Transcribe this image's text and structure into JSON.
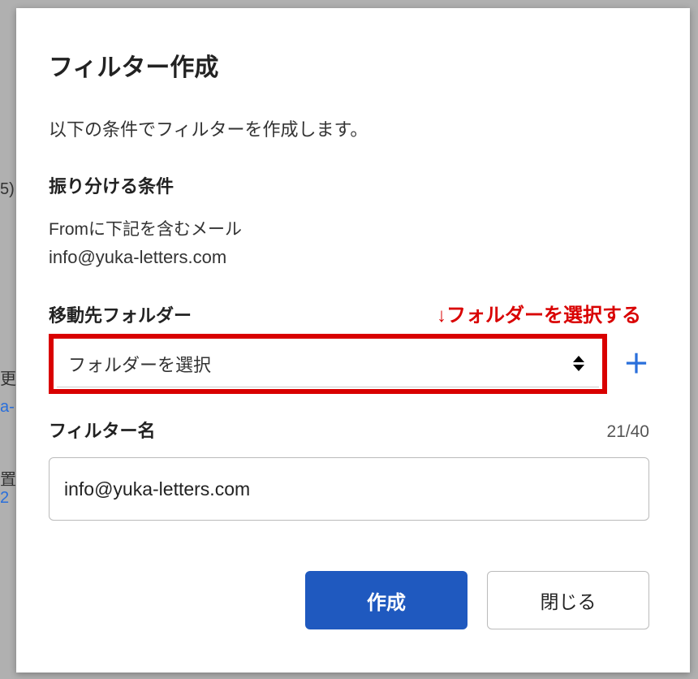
{
  "dialog": {
    "title": "フィルター作成",
    "intro": "以下の条件でフィルターを作成します。",
    "conditions_label": "振り分ける条件",
    "condition_line1": "Fromに下記を含むメール",
    "condition_line2": "info@yuka-letters.com",
    "folder_label": "移動先フォルダー",
    "annotation": "↓フォルダーを選択する",
    "folder_placeholder": "フォルダーを選択",
    "plus_symbol": "＋",
    "filtername_label": "フィルター名",
    "filtername_counter": "21/40",
    "filtername_value": "info@yuka-letters.com",
    "create_btn": "作成",
    "close_btn": "閉じる"
  },
  "background_fragments": {
    "frag1": "5)",
    "frag2": "更",
    "frag3": "a-",
    "frag4": "置",
    "frag5": "2"
  }
}
